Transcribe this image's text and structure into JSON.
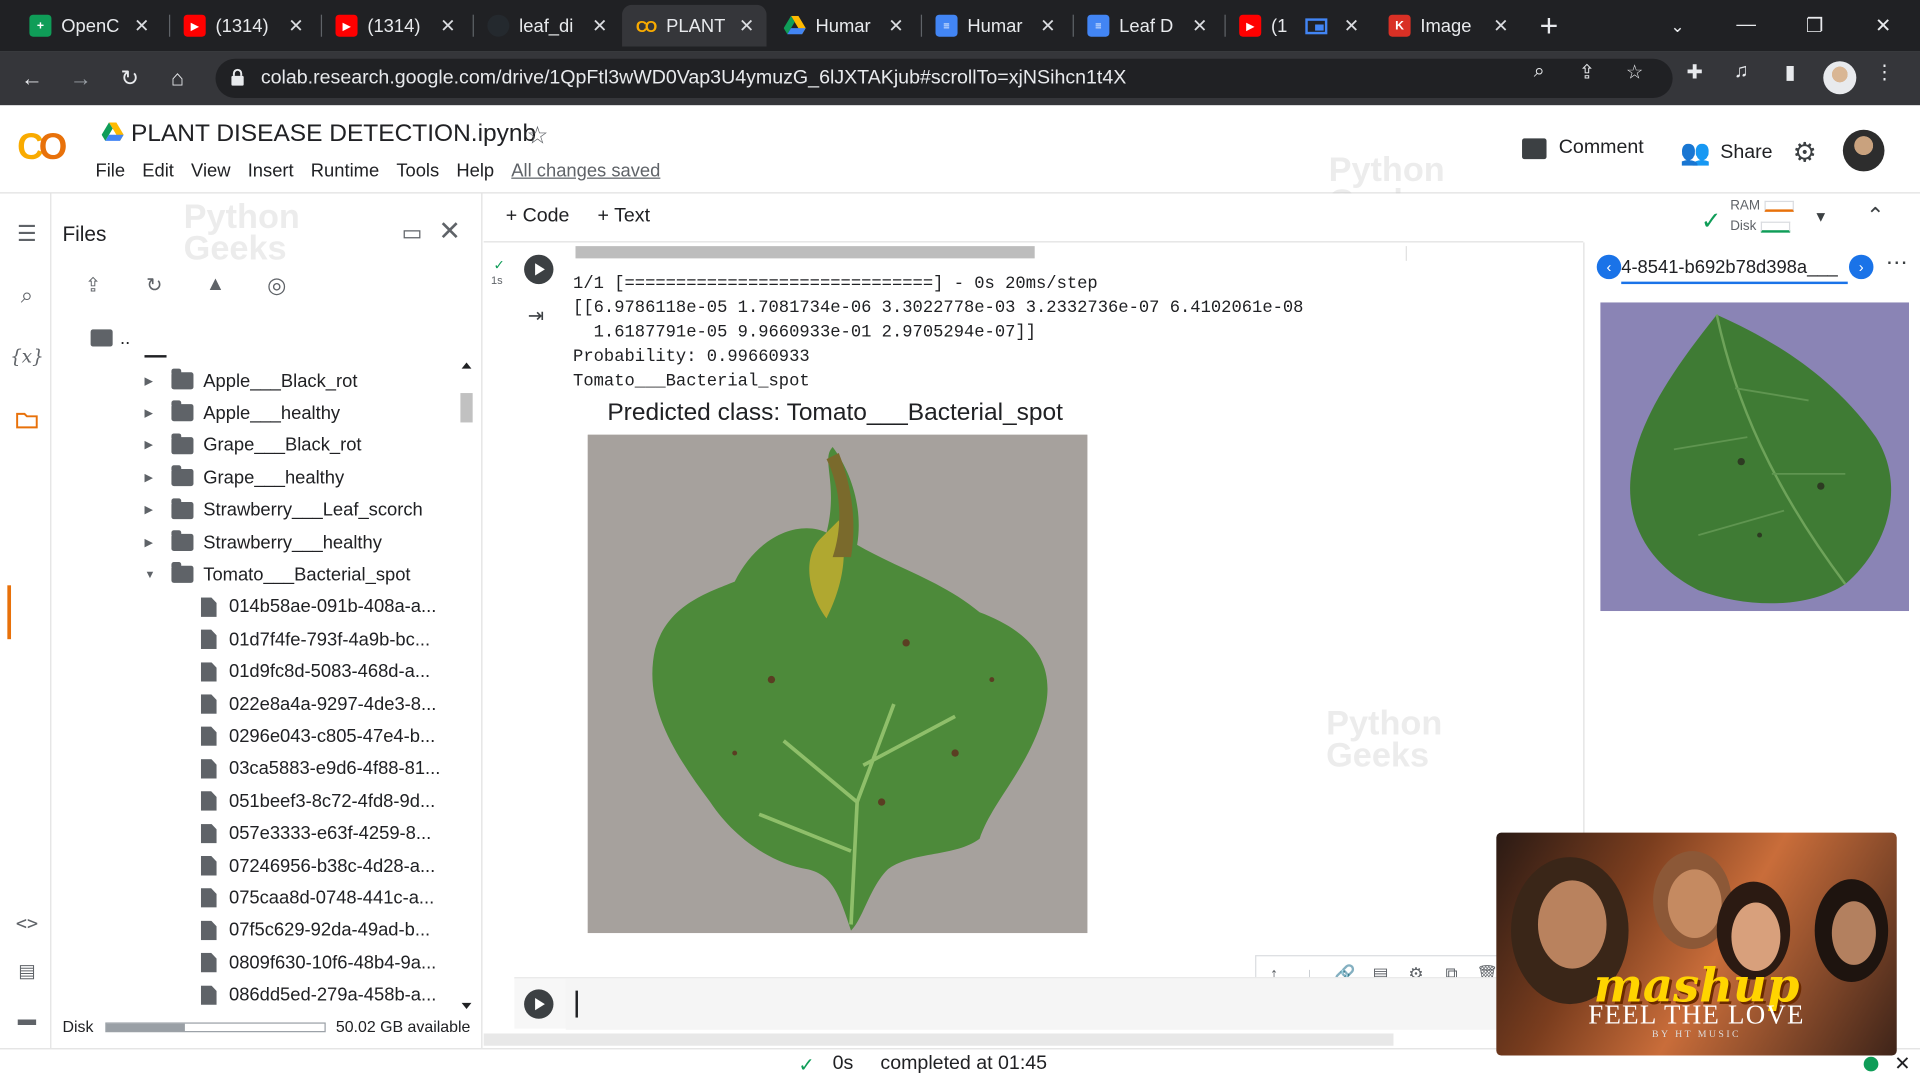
{
  "browser": {
    "tabs": [
      {
        "title": "OpenC",
        "icon": "sheets-icon"
      },
      {
        "title": "(1314)",
        "icon": "youtube-icon"
      },
      {
        "title": "(1314)",
        "icon": "youtube-icon"
      },
      {
        "title": "leaf_di",
        "icon": "github-icon"
      },
      {
        "title": "PLANT",
        "icon": "colab-icon"
      },
      {
        "title": "Humar",
        "icon": "drive-icon"
      },
      {
        "title": "Humar",
        "icon": "docs-icon"
      },
      {
        "title": "Leaf D",
        "icon": "docs-icon"
      },
      {
        "title": "(1",
        "icon": "youtube-icon"
      },
      {
        "title": "Image",
        "icon": "kaggle-icon"
      }
    ],
    "active_tab": 4,
    "url": "colab.research.google.com/drive/1QpFtl3wWD0Vap3U4ymuzG_6lJXTAKjub#scrollTo=xjNSihcn1t4X"
  },
  "colab": {
    "notebook_title": "PLANT DISEASE DETECTION.ipynb",
    "menu": [
      "File",
      "Edit",
      "View",
      "Insert",
      "Runtime",
      "Tools",
      "Help"
    ],
    "save_status": "All changes saved",
    "comment_label": "Comment",
    "share_label": "Share",
    "add_code_label": "+ Code",
    "add_text_label": "+ Text",
    "ram_label": "RAM",
    "disk_label": "Disk",
    "cell_status_time": "1s"
  },
  "files_panel": {
    "title": "Files",
    "parent_label": "..",
    "folders": [
      "Apple___Black_rot",
      "Apple___healthy",
      "Grape___Black_rot",
      "Grape___healthy",
      "Strawberry___Leaf_scorch",
      "Strawberry___healthy",
      "Tomato___Bacterial_spot"
    ],
    "files": [
      "014b58ae-091b-408a-a...",
      "01d7f4fe-793f-4a9b-bc...",
      "01d9fc8d-5083-468d-a...",
      "022e8a4a-9297-4de3-8...",
      "0296e043-c805-47e4-b...",
      "03ca5883-e9d6-4f88-81...",
      "051beef3-8c72-4fd8-9d...",
      "057e3333-e63f-4259-8...",
      "07246956-b38c-4d28-a...",
      "075caa8d-0748-441c-a...",
      "07f5c629-92da-49ad-b...",
      "0809f630-10f6-48b4-9a...",
      "086dd5ed-279a-458b-a..."
    ],
    "disk_label": "Disk",
    "disk_available": "50.02 GB available",
    "disk_used_fraction": 0.36
  },
  "output": {
    "progress_line": "1/1 [==============================] - 0s 20ms/step",
    "array_line1": "[[6.9786118e-05 1.7081734e-06 3.3022778e-03 3.2332736e-07 6.4102061e-08",
    "array_line2": "  1.6187791e-05 9.9660933e-01 2.9705294e-07]]",
    "probability_line": "Probability: 0.99660933",
    "class_line": "Tomato___Bacterial_spot",
    "plot_title": "Predicted class: Tomato___Bacterial_spot"
  },
  "viewer": {
    "tab_title": "4-8541-b692b78d398a___"
  },
  "status_bar": {
    "duration": "0s",
    "completed": "completed at 01:45"
  },
  "mini_player": {
    "title": "mashup",
    "subtitle": "FEEL THE LOVE",
    "credit": "BY HT MUSIC"
  },
  "watermark": {
    "line1": "Python",
    "line2": "Geeks"
  },
  "colors": {
    "chrome_dark": "#202124",
    "chrome_toolbar": "#35363a",
    "colab_orange": "#e8710a",
    "colab_yellow": "#f9ab00",
    "accent_blue": "#1a73e8"
  }
}
